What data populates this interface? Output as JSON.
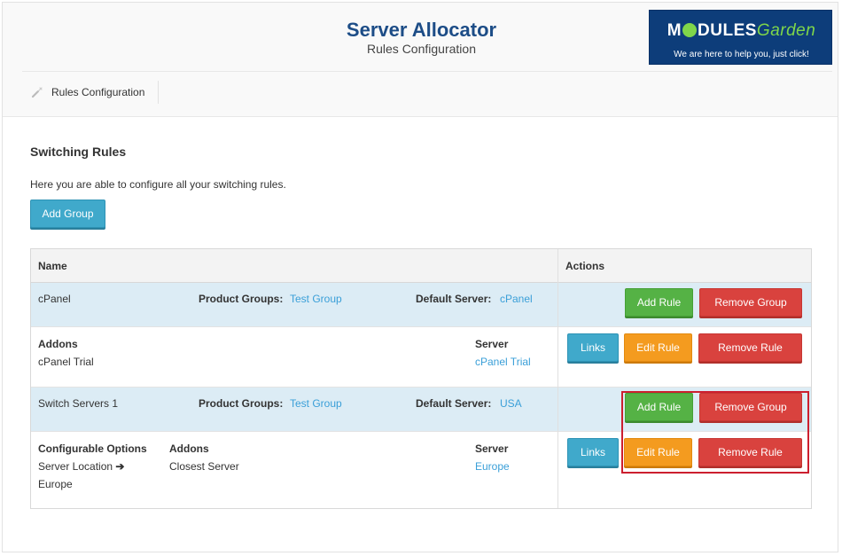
{
  "header": {
    "title": "Server Allocator",
    "subtitle": "Rules Configuration"
  },
  "logo": {
    "brand_prefix": "M",
    "brand_mid": "DULES",
    "brand_suffix": "Garden",
    "tagline": "We are here to help you, just click!"
  },
  "nav": {
    "tab_label": "Rules Configuration",
    "tab_icon": "wrench-icon"
  },
  "section": {
    "title": "Switching Rules",
    "description": "Here you are able to configure all your switching rules.",
    "add_group_label": "Add Group"
  },
  "table": {
    "headers": {
      "name": "Name",
      "actions": "Actions"
    },
    "groups": [
      {
        "name": "cPanel",
        "product_groups_label": "Product Groups:",
        "product_groups_value": "Test Group",
        "default_server_label": "Default Server:",
        "default_server_value": "cPanel",
        "add_rule_label": "Add Rule",
        "remove_group_label": "Remove Group",
        "rule": {
          "addons_label": "Addons",
          "addons_value": "cPanel Trial",
          "server_label": "Server",
          "server_value": "cPanel Trial",
          "links_label": "Links",
          "edit_label": "Edit Rule",
          "remove_label": "Remove Rule"
        }
      },
      {
        "name": "Switch Servers 1",
        "product_groups_label": "Product Groups:",
        "product_groups_value": "Test Group",
        "default_server_label": "Default Server:",
        "default_server_value": "USA",
        "add_rule_label": "Add Rule",
        "remove_group_label": "Remove Group",
        "rule": {
          "config_label": "Configurable Options",
          "config_option": "Server Location",
          "config_arrow": "➔",
          "config_value": "Europe",
          "addons_label": "Addons",
          "addons_value": "Closest Server",
          "server_label": "Server",
          "server_value": "Europe",
          "links_label": "Links",
          "edit_label": "Edit Rule",
          "remove_label": "Remove Rule"
        }
      }
    ]
  },
  "colors": {
    "title": "#1d4d87",
    "link": "#3a9fd8",
    "group_row_bg": "#dcecf5",
    "btn_info": "#40a9cb",
    "btn_success": "#55b245",
    "btn_warning": "#f49b1f",
    "btn_danger": "#d9423e",
    "highlight": "#cc1f2f"
  }
}
